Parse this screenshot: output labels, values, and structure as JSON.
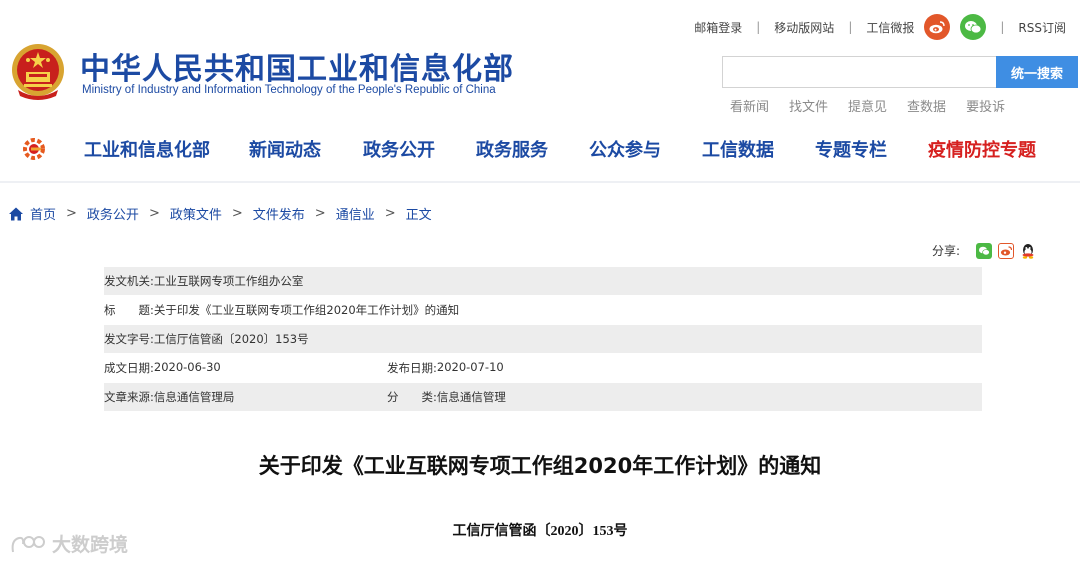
{
  "header": {
    "title": "中华人民共和国工业和信息化部",
    "subtitle": "Ministry of Industry and Information Technology of the People's Republic of China",
    "top_links": [
      "邮箱登录",
      "移动版网站",
      "工信微报",
      "RSS订阅"
    ],
    "search": {
      "value": "",
      "button": "统一搜索"
    },
    "quick_links": [
      "看新闻",
      "找文件",
      "提意见",
      "查数据",
      "要投诉"
    ]
  },
  "nav": {
    "items": [
      "工业和信息化部",
      "新闻动态",
      "政务公开",
      "政务服务",
      "公众参与",
      "工信数据",
      "专题专栏",
      "疫情防控专题"
    ]
  },
  "breadcrumb": [
    "首页",
    "政务公开",
    "政策文件",
    "文件发布",
    "通信业",
    "正文"
  ],
  "share": {
    "label": "分享:"
  },
  "info": {
    "issuer_label": "发文机关:",
    "issuer": "工业互联网专项工作组办公室",
    "title_label": "标　　题:",
    "title": "关于印发《工业互联网专项工作组2020年工作计划》的通知",
    "docno_label": "发文字号:",
    "docno": "工信厅信管函〔2020〕153号",
    "created_label": "成文日期:",
    "created": "2020-06-30",
    "published_label": "发布日期:",
    "published": "2020-07-10",
    "source_label": "文章来源:",
    "source": "信息通信管理局",
    "category_label": "分　　类:",
    "category": "信息通信管理"
  },
  "article": {
    "title": "关于印发《工业互联网专项工作组2020年工作计划》的通知",
    "doc_number": "工信厅信管函〔2020〕153号"
  },
  "watermark": "大数跨境",
  "colors": {
    "brand_blue": "#1c4aa3",
    "accent_red": "#d6201f",
    "search_blue": "#3f8ee3",
    "row_gray": "#ededed"
  },
  "icons": [
    "national-emblem-icon",
    "weibo-icon",
    "wechat-icon",
    "nav-logo-icon",
    "home-icon",
    "share-wechat-icon",
    "share-weibo-icon",
    "share-qq-icon"
  ]
}
